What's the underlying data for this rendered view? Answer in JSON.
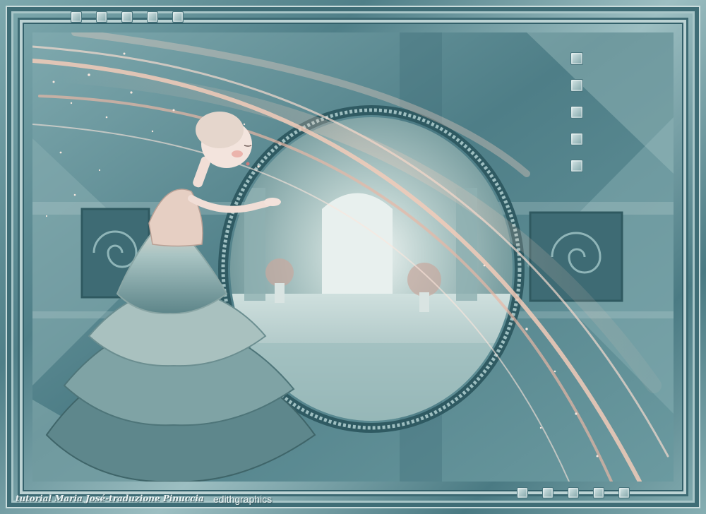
{
  "credits": {
    "tutorial": "tutorial Maria José-traduzione Pinuccia",
    "artist": "edithgraphics"
  },
  "colors": {
    "teal_dark": "#3d6a73",
    "teal_mid": "#6f9ba2",
    "teal_light": "#bcd3d4",
    "peach": "#e9b9a6",
    "skin": "#f1ded6"
  }
}
